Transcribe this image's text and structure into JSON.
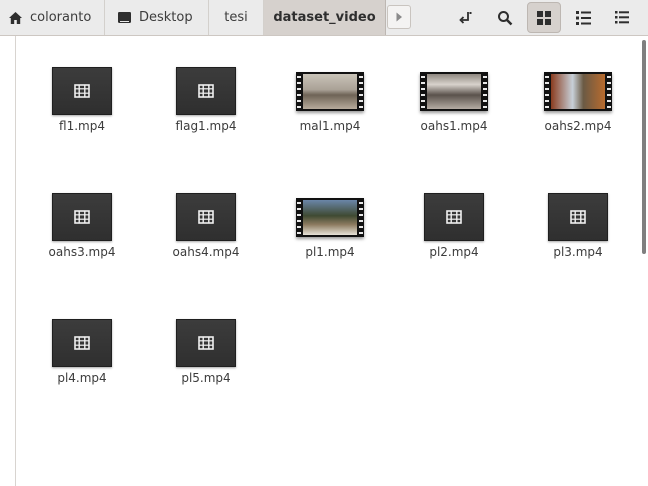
{
  "breadcrumbs": [
    {
      "label": "coloranto",
      "icon": "home-icon"
    },
    {
      "label": "Desktop",
      "icon": "desktop-icon"
    },
    {
      "label": "tesi"
    },
    {
      "label": "dataset_video",
      "current": true
    }
  ],
  "toolbar": {
    "buttons": [
      "open-location-icon",
      "search-icon",
      "grid-view-icon",
      "list-view-icon",
      "menu-icon"
    ],
    "active_view": "grid"
  },
  "files": [
    {
      "name": "fl1.mp4",
      "thumb": "generic"
    },
    {
      "name": "flag1.mp4",
      "thumb": "generic"
    },
    {
      "name": "mal1.mp4",
      "thumb": "video"
    },
    {
      "name": "oahs1.mp4",
      "thumb": "video"
    },
    {
      "name": "oahs2.mp4",
      "thumb": "video"
    },
    {
      "name": "oahs3.mp4",
      "thumb": "generic"
    },
    {
      "name": "oahs4.mp4",
      "thumb": "generic"
    },
    {
      "name": "pl1.mp4",
      "thumb": "video"
    },
    {
      "name": "pl2.mp4",
      "thumb": "generic"
    },
    {
      "name": "pl3.mp4",
      "thumb": "generic"
    },
    {
      "name": "pl4.mp4",
      "thumb": "generic"
    },
    {
      "name": "pl5.mp4",
      "thumb": "generic"
    }
  ],
  "colors": {
    "headerbar": "#ebebeb",
    "active_crumb": "#d6d1cd",
    "generic_thumb": "#353535",
    "background": "#ffffff"
  }
}
